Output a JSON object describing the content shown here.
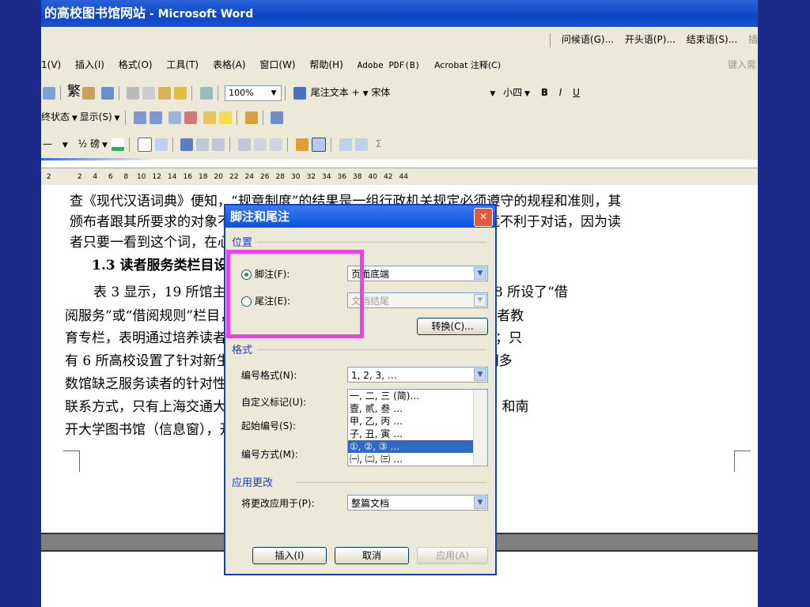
{
  "window": {
    "title": "的高校图书馆网站",
    "app": " - Microsoft Word"
  },
  "mail_toolbar": [
    "问候语(G)...",
    "开头语(P)...",
    "结束语(S)...",
    "插"
  ],
  "menu": [
    "1(V)",
    "插入(I)",
    "格式(O)",
    "工具(T)",
    "表格(A)",
    "窗口(W)",
    "帮助(H)",
    "Adobe PDF(B)",
    "Acrobat 注释(C)"
  ],
  "menu_right": "键入需",
  "format_bar": {
    "zoom": "100%",
    "style": "尾注文本 +",
    "font": "宋体",
    "size": "小四",
    "trad": "繁",
    "bold": "B",
    "italic": "I",
    "underline": "U"
  },
  "review_bar": {
    "state": "终状态",
    "show": "显示(S)"
  },
  "draw_bar": {
    "weight": "½ 磅"
  },
  "ruler": [
    "2",
    "",
    "2",
    "4",
    "6",
    "8",
    "10",
    "12",
    "14",
    "16",
    "18",
    "20",
    "22",
    "24",
    "26",
    "28",
    "30",
    "32",
    "34",
    "36",
    "38",
    "40",
    "42",
    "44"
  ],
  "document": {
    "p1": "查《现代汉语词典》便知，“规章制度”的结果是一组行政机关规定必须遵守的规程和准则，其",
    "p2": "颁布者跟其所要求的对象不同，是一种管理者的口气。这样的栏目名称就不利于对话，因为读",
    "p3": "者只要一看到这个词，在心理上就会有一种被约束的感觉。",
    "heading": "1.3 读者服务类栏目设置",
    "p4": "表 3 显示，19 所馆主页中设置了各种内容的读者服务项目。其中 18 所设了“借",
    "p5": "阅服务”或“借阅规则”栏目，所有网站都提供了借阅服务；18 所设置了读者教",
    "p6": "育专栏，表明通过培养读者的信息素养来提高资源利用率成为各馆的共识；只",
    "p7": "有 6 所高校设置了针对新生、教师等不同读者对象的个性服务栏目，表明多",
    "p8": "数馆缺乏服务读者的针对性。学科馆员栏目主要是介绍学科馆员的职责和",
    "p9": "联系方式，只有上海交通大学图书馆（学科服务）、书馆（学科专题综述）和南",
    "p10": "开大学图书馆（信息窗），开展了多种学科服务。"
  },
  "dialog": {
    "title": "脚注和尾注",
    "close": "✕",
    "location_group": "位置",
    "footnote_label": "脚注(F):",
    "footnote_value": "页面底端",
    "endnote_label": "尾注(E):",
    "endnote_value": "文档结尾",
    "convert_button": "转换(C)...",
    "format_group": "格式",
    "number_format_label": "编号格式(N):",
    "number_format_value": "1, 2, 3, …",
    "custom_mark_label": "自定义标记(U):",
    "start_at_label": "起始编号(S):",
    "numbering_label": "编号方式(M):",
    "list_items": [
      "一, 二, 三 (简)…",
      "壹, 贰, 叁 …",
      "甲, 乙, 丙 …",
      "子, 丑, 寅 …",
      "①, ②, ③ …",
      "㈠, ㈡, ㈢ …"
    ],
    "apply_group": "应用更改",
    "apply_to_label": "将更改应用于(P):",
    "apply_to_value": "整篇文档",
    "insert_button": "插入(I)",
    "cancel_button": "取消",
    "apply_button": "应用(A)"
  },
  "colors": {
    "slide_bg": "#1c2a8a",
    "highlight": "#f23fe4",
    "titlebar": "#0d47c6"
  }
}
